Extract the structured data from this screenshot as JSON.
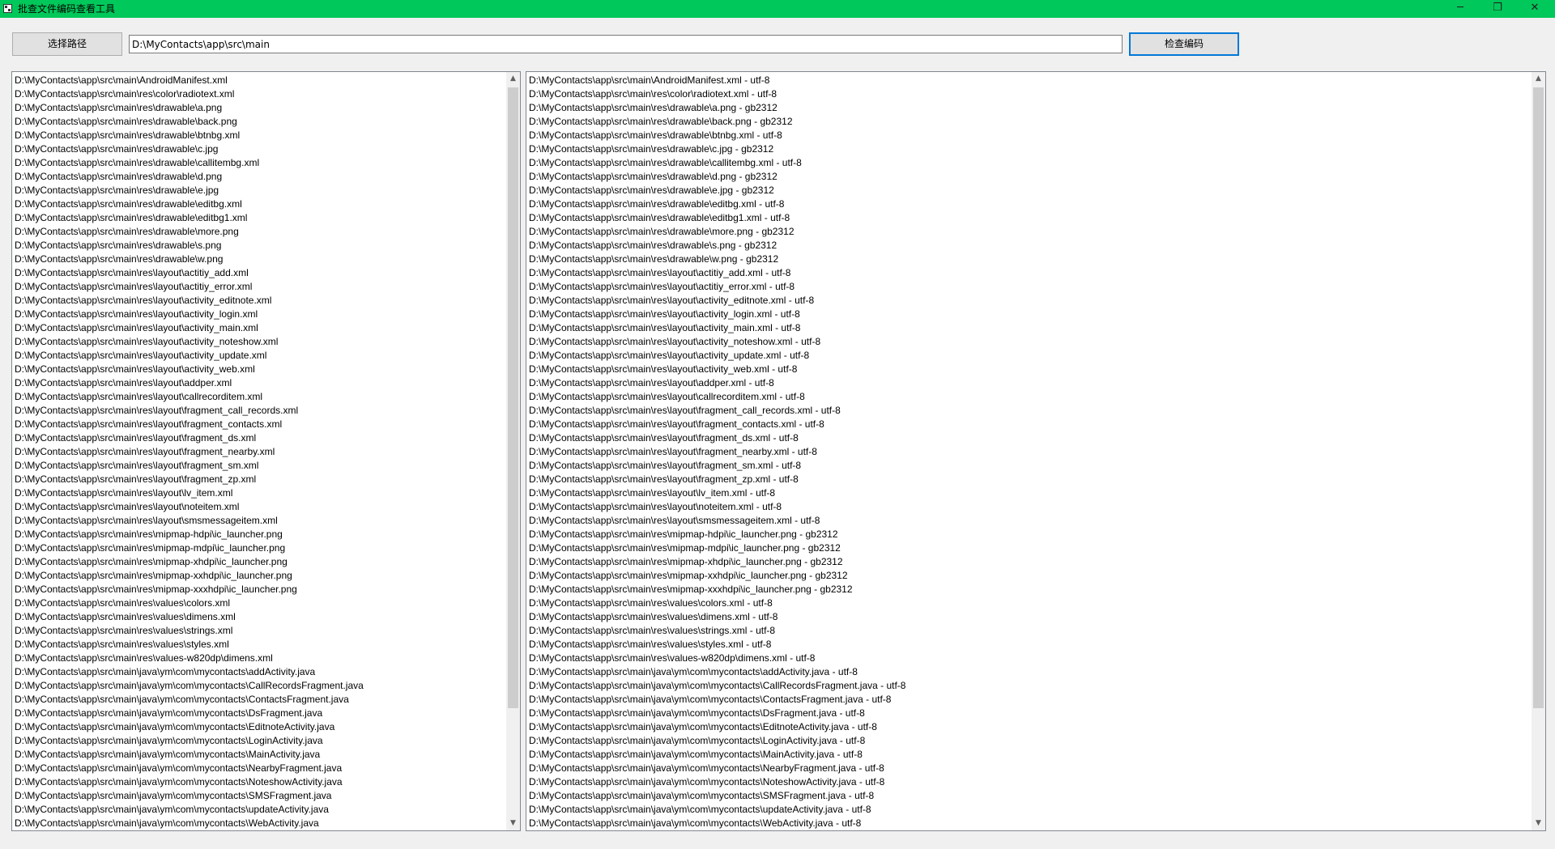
{
  "window": {
    "title": "批查文件编码查看工具",
    "accent": "#00c85a",
    "minimize_glyph": "─",
    "maximize_glyph": "❐",
    "close_glyph": "✕"
  },
  "toolbar": {
    "select_path_label": "选择路径",
    "path_value": "D:\\MyContacts\\app\\src\\main",
    "check_encoding_label": "检查编码"
  },
  "scroll": {
    "up_glyph": "▲",
    "down_glyph": "▼"
  },
  "files": [
    "D:\\MyContacts\\app\\src\\main\\AndroidManifest.xml",
    "D:\\MyContacts\\app\\src\\main\\res\\color\\radiotext.xml",
    "D:\\MyContacts\\app\\src\\main\\res\\drawable\\a.png",
    "D:\\MyContacts\\app\\src\\main\\res\\drawable\\back.png",
    "D:\\MyContacts\\app\\src\\main\\res\\drawable\\btnbg.xml",
    "D:\\MyContacts\\app\\src\\main\\res\\drawable\\c.jpg",
    "D:\\MyContacts\\app\\src\\main\\res\\drawable\\callitembg.xml",
    "D:\\MyContacts\\app\\src\\main\\res\\drawable\\d.png",
    "D:\\MyContacts\\app\\src\\main\\res\\drawable\\e.jpg",
    "D:\\MyContacts\\app\\src\\main\\res\\drawable\\editbg.xml",
    "D:\\MyContacts\\app\\src\\main\\res\\drawable\\editbg1.xml",
    "D:\\MyContacts\\app\\src\\main\\res\\drawable\\more.png",
    "D:\\MyContacts\\app\\src\\main\\res\\drawable\\s.png",
    "D:\\MyContacts\\app\\src\\main\\res\\drawable\\w.png",
    "D:\\MyContacts\\app\\src\\main\\res\\layout\\actitiy_add.xml",
    "D:\\MyContacts\\app\\src\\main\\res\\layout\\actitiy_error.xml",
    "D:\\MyContacts\\app\\src\\main\\res\\layout\\activity_editnote.xml",
    "D:\\MyContacts\\app\\src\\main\\res\\layout\\activity_login.xml",
    "D:\\MyContacts\\app\\src\\main\\res\\layout\\activity_main.xml",
    "D:\\MyContacts\\app\\src\\main\\res\\layout\\activity_noteshow.xml",
    "D:\\MyContacts\\app\\src\\main\\res\\layout\\activity_update.xml",
    "D:\\MyContacts\\app\\src\\main\\res\\layout\\activity_web.xml",
    "D:\\MyContacts\\app\\src\\main\\res\\layout\\addper.xml",
    "D:\\MyContacts\\app\\src\\main\\res\\layout\\callrecorditem.xml",
    "D:\\MyContacts\\app\\src\\main\\res\\layout\\fragment_call_records.xml",
    "D:\\MyContacts\\app\\src\\main\\res\\layout\\fragment_contacts.xml",
    "D:\\MyContacts\\app\\src\\main\\res\\layout\\fragment_ds.xml",
    "D:\\MyContacts\\app\\src\\main\\res\\layout\\fragment_nearby.xml",
    "D:\\MyContacts\\app\\src\\main\\res\\layout\\fragment_sm.xml",
    "D:\\MyContacts\\app\\src\\main\\res\\layout\\fragment_zp.xml",
    "D:\\MyContacts\\app\\src\\main\\res\\layout\\lv_item.xml",
    "D:\\MyContacts\\app\\src\\main\\res\\layout\\noteitem.xml",
    "D:\\MyContacts\\app\\src\\main\\res\\layout\\smsmessageitem.xml",
    "D:\\MyContacts\\app\\src\\main\\res\\mipmap-hdpi\\ic_launcher.png",
    "D:\\MyContacts\\app\\src\\main\\res\\mipmap-mdpi\\ic_launcher.png",
    "D:\\MyContacts\\app\\src\\main\\res\\mipmap-xhdpi\\ic_launcher.png",
    "D:\\MyContacts\\app\\src\\main\\res\\mipmap-xxhdpi\\ic_launcher.png",
    "D:\\MyContacts\\app\\src\\main\\res\\mipmap-xxxhdpi\\ic_launcher.png",
    "D:\\MyContacts\\app\\src\\main\\res\\values\\colors.xml",
    "D:\\MyContacts\\app\\src\\main\\res\\values\\dimens.xml",
    "D:\\MyContacts\\app\\src\\main\\res\\values\\strings.xml",
    "D:\\MyContacts\\app\\src\\main\\res\\values\\styles.xml",
    "D:\\MyContacts\\app\\src\\main\\res\\values-w820dp\\dimens.xml",
    "D:\\MyContacts\\app\\src\\main\\java\\ym\\com\\mycontacts\\addActivity.java",
    "D:\\MyContacts\\app\\src\\main\\java\\ym\\com\\mycontacts\\CallRecordsFragment.java",
    "D:\\MyContacts\\app\\src\\main\\java\\ym\\com\\mycontacts\\ContactsFragment.java",
    "D:\\MyContacts\\app\\src\\main\\java\\ym\\com\\mycontacts\\DsFragment.java",
    "D:\\MyContacts\\app\\src\\main\\java\\ym\\com\\mycontacts\\EditnoteActivity.java",
    "D:\\MyContacts\\app\\src\\main\\java\\ym\\com\\mycontacts\\LoginActivity.java",
    "D:\\MyContacts\\app\\src\\main\\java\\ym\\com\\mycontacts\\MainActivity.java",
    "D:\\MyContacts\\app\\src\\main\\java\\ym\\com\\mycontacts\\NearbyFragment.java",
    "D:\\MyContacts\\app\\src\\main\\java\\ym\\com\\mycontacts\\NoteshowActivity.java",
    "D:\\MyContacts\\app\\src\\main\\java\\ym\\com\\mycontacts\\SMSFragment.java",
    "D:\\MyContacts\\app\\src\\main\\java\\ym\\com\\mycontacts\\updateActivity.java",
    "D:\\MyContacts\\app\\src\\main\\java\\ym\\com\\mycontacts\\WebActivity.java"
  ],
  "results": [
    "D:\\MyContacts\\app\\src\\main\\AndroidManifest.xml - utf-8",
    "D:\\MyContacts\\app\\src\\main\\res\\color\\radiotext.xml - utf-8",
    "D:\\MyContacts\\app\\src\\main\\res\\drawable\\a.png - gb2312",
    "D:\\MyContacts\\app\\src\\main\\res\\drawable\\back.png - gb2312",
    "D:\\MyContacts\\app\\src\\main\\res\\drawable\\btnbg.xml - utf-8",
    "D:\\MyContacts\\app\\src\\main\\res\\drawable\\c.jpg - gb2312",
    "D:\\MyContacts\\app\\src\\main\\res\\drawable\\callitembg.xml - utf-8",
    "D:\\MyContacts\\app\\src\\main\\res\\drawable\\d.png - gb2312",
    "D:\\MyContacts\\app\\src\\main\\res\\drawable\\e.jpg - gb2312",
    "D:\\MyContacts\\app\\src\\main\\res\\drawable\\editbg.xml - utf-8",
    "D:\\MyContacts\\app\\src\\main\\res\\drawable\\editbg1.xml - utf-8",
    "D:\\MyContacts\\app\\src\\main\\res\\drawable\\more.png - gb2312",
    "D:\\MyContacts\\app\\src\\main\\res\\drawable\\s.png - gb2312",
    "D:\\MyContacts\\app\\src\\main\\res\\drawable\\w.png - gb2312",
    "D:\\MyContacts\\app\\src\\main\\res\\layout\\actitiy_add.xml - utf-8",
    "D:\\MyContacts\\app\\src\\main\\res\\layout\\actitiy_error.xml - utf-8",
    "D:\\MyContacts\\app\\src\\main\\res\\layout\\activity_editnote.xml - utf-8",
    "D:\\MyContacts\\app\\src\\main\\res\\layout\\activity_login.xml - utf-8",
    "D:\\MyContacts\\app\\src\\main\\res\\layout\\activity_main.xml - utf-8",
    "D:\\MyContacts\\app\\src\\main\\res\\layout\\activity_noteshow.xml - utf-8",
    "D:\\MyContacts\\app\\src\\main\\res\\layout\\activity_update.xml - utf-8",
    "D:\\MyContacts\\app\\src\\main\\res\\layout\\activity_web.xml - utf-8",
    "D:\\MyContacts\\app\\src\\main\\res\\layout\\addper.xml - utf-8",
    "D:\\MyContacts\\app\\src\\main\\res\\layout\\callrecorditem.xml - utf-8",
    "D:\\MyContacts\\app\\src\\main\\res\\layout\\fragment_call_records.xml - utf-8",
    "D:\\MyContacts\\app\\src\\main\\res\\layout\\fragment_contacts.xml - utf-8",
    "D:\\MyContacts\\app\\src\\main\\res\\layout\\fragment_ds.xml - utf-8",
    "D:\\MyContacts\\app\\src\\main\\res\\layout\\fragment_nearby.xml - utf-8",
    "D:\\MyContacts\\app\\src\\main\\res\\layout\\fragment_sm.xml - utf-8",
    "D:\\MyContacts\\app\\src\\main\\res\\layout\\fragment_zp.xml - utf-8",
    "D:\\MyContacts\\app\\src\\main\\res\\layout\\lv_item.xml - utf-8",
    "D:\\MyContacts\\app\\src\\main\\res\\layout\\noteitem.xml - utf-8",
    "D:\\MyContacts\\app\\src\\main\\res\\layout\\smsmessageitem.xml - utf-8",
    "D:\\MyContacts\\app\\src\\main\\res\\mipmap-hdpi\\ic_launcher.png - gb2312",
    "D:\\MyContacts\\app\\src\\main\\res\\mipmap-mdpi\\ic_launcher.png - gb2312",
    "D:\\MyContacts\\app\\src\\main\\res\\mipmap-xhdpi\\ic_launcher.png - gb2312",
    "D:\\MyContacts\\app\\src\\main\\res\\mipmap-xxhdpi\\ic_launcher.png - gb2312",
    "D:\\MyContacts\\app\\src\\main\\res\\mipmap-xxxhdpi\\ic_launcher.png - gb2312",
    "D:\\MyContacts\\app\\src\\main\\res\\values\\colors.xml - utf-8",
    "D:\\MyContacts\\app\\src\\main\\res\\values\\dimens.xml - utf-8",
    "D:\\MyContacts\\app\\src\\main\\res\\values\\strings.xml - utf-8",
    "D:\\MyContacts\\app\\src\\main\\res\\values\\styles.xml - utf-8",
    "D:\\MyContacts\\app\\src\\main\\res\\values-w820dp\\dimens.xml - utf-8",
    "D:\\MyContacts\\app\\src\\main\\java\\ym\\com\\mycontacts\\addActivity.java - utf-8",
    "D:\\MyContacts\\app\\src\\main\\java\\ym\\com\\mycontacts\\CallRecordsFragment.java - utf-8",
    "D:\\MyContacts\\app\\src\\main\\java\\ym\\com\\mycontacts\\ContactsFragment.java - utf-8",
    "D:\\MyContacts\\app\\src\\main\\java\\ym\\com\\mycontacts\\DsFragment.java - utf-8",
    "D:\\MyContacts\\app\\src\\main\\java\\ym\\com\\mycontacts\\EditnoteActivity.java - utf-8",
    "D:\\MyContacts\\app\\src\\main\\java\\ym\\com\\mycontacts\\LoginActivity.java - utf-8",
    "D:\\MyContacts\\app\\src\\main\\java\\ym\\com\\mycontacts\\MainActivity.java - utf-8",
    "D:\\MyContacts\\app\\src\\main\\java\\ym\\com\\mycontacts\\NearbyFragment.java - utf-8",
    "D:\\MyContacts\\app\\src\\main\\java\\ym\\com\\mycontacts\\NoteshowActivity.java - utf-8",
    "D:\\MyContacts\\app\\src\\main\\java\\ym\\com\\mycontacts\\SMSFragment.java - utf-8",
    "D:\\MyContacts\\app\\src\\main\\java\\ym\\com\\mycontacts\\updateActivity.java - utf-8",
    "D:\\MyContacts\\app\\src\\main\\java\\ym\\com\\mycontacts\\WebActivity.java - utf-8"
  ]
}
